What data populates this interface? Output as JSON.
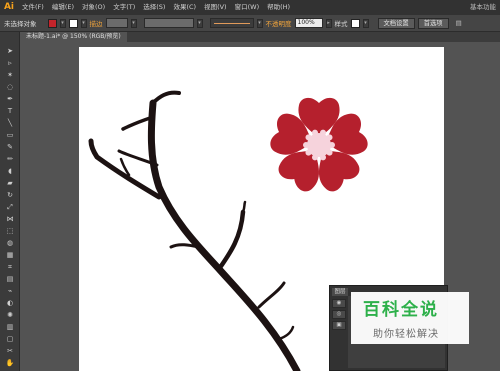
{
  "app": {
    "logo": "Ai"
  },
  "menubar": {
    "items": [
      "文件(F)",
      "编辑(E)",
      "对象(O)",
      "文字(T)",
      "选择(S)",
      "效果(C)",
      "视图(V)",
      "窗口(W)",
      "帮助(H)"
    ],
    "workspace": "基本功能"
  },
  "controlbar": {
    "selection_label": "未选择对象",
    "fill_color": "#c4242b",
    "stroke_label": "描边",
    "opacity_label": "不透明度",
    "opacity_value": "100%",
    "style_label": "样式",
    "doc_setup_button": "文档设置",
    "preferences_button": "首选项"
  },
  "document": {
    "tab_title": "未标题-1.ai* @ 150% (RGB/预览)"
  },
  "artwork": {
    "flower_color": "#b5202d",
    "flower_center_color": "#f6d3dc",
    "branch_color": "#1c1212"
  },
  "layers_panel": {
    "tab_label": "图层"
  },
  "watermark": {
    "title": "百科全说",
    "subtitle": "助你轻松解决"
  }
}
